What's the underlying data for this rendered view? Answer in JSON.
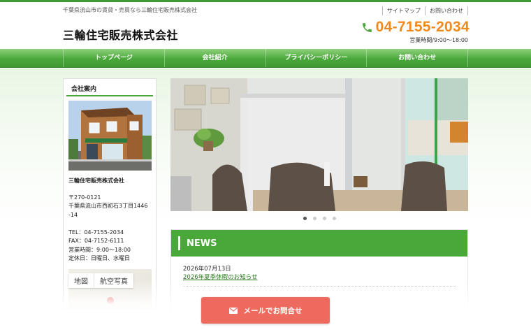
{
  "header": {
    "tagline": "千葉県流山市の賃貸・売買なら三輪住宅販売株式会社",
    "logo": "三輪住宅販売株式会社",
    "links": [
      "サイトマップ",
      "お問い合わせ"
    ],
    "phone": "04-7155-2034",
    "hours": "営業時間/9:00〜18:00",
    "phone_icon": "phone-icon",
    "accent_green": "#4aa83b",
    "accent_orange": "#f08a1c"
  },
  "nav": {
    "items": [
      "トップページ",
      "会社紹介",
      "プライバシーポリシー",
      "お問い合わせ"
    ]
  },
  "sidebar": {
    "title": "会社案内",
    "company": "三輪住宅販売株式会社",
    "postal": "〒270-0121",
    "address1": "千葉県流山市西初石3丁目1446",
    "address2": "-14",
    "tel": "TEL：04-7155-2034",
    "fax": "FAX：04-7152-6111",
    "hours": "営業時間：9:00〜18:00",
    "holidays": "定休日：日曜日、水曜日",
    "map_tabs": [
      "地図",
      "航空写真"
    ]
  },
  "slider": {
    "dot_count": 4,
    "active_index": 0
  },
  "news": {
    "title": "NEWS",
    "items": [
      {
        "date": "2026年07月13日",
        "title": "2026年夏季休暇のお知らせ"
      }
    ]
  },
  "cta": {
    "label": "メールでお問合せ",
    "icon": "mail-icon",
    "color": "#ee6a5e"
  }
}
